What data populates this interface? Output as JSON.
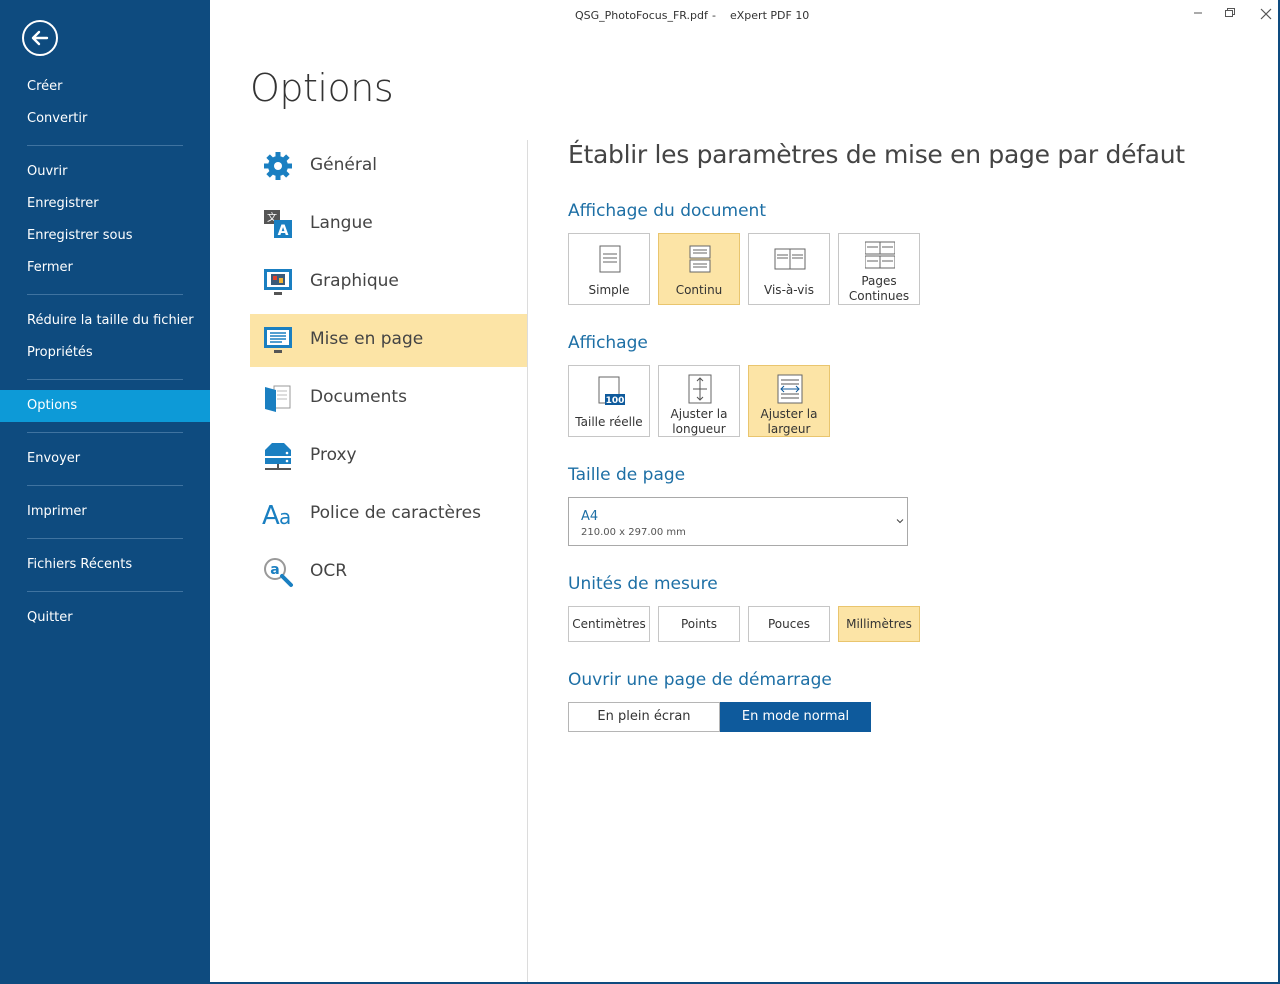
{
  "window": {
    "doc_name": "QSG_PhotoFocus_FR.pdf",
    "separator": "-",
    "app_name": "eXpert PDF 10"
  },
  "sidebar": {
    "items": [
      {
        "label": "Créer"
      },
      {
        "label": "Convertir"
      },
      {
        "label": "Ouvrir"
      },
      {
        "label": "Enregistrer"
      },
      {
        "label": "Enregistrer sous"
      },
      {
        "label": "Fermer"
      },
      {
        "label": "Réduire la taille du fichier"
      },
      {
        "label": "Propriétés"
      },
      {
        "label": "Options",
        "active": true
      },
      {
        "label": "Envoyer"
      },
      {
        "label": "Imprimer"
      },
      {
        "label": "Fichiers Récents"
      },
      {
        "label": "Quitter"
      }
    ]
  },
  "page": {
    "title": "Options"
  },
  "categories": [
    {
      "label": "Général",
      "icon": "gear-icon"
    },
    {
      "label": "Langue",
      "icon": "language-icon"
    },
    {
      "label": "Graphique",
      "icon": "monitor-graphic-icon"
    },
    {
      "label": "Mise en page",
      "icon": "page-layout-icon",
      "active": true
    },
    {
      "label": "Documents",
      "icon": "documents-icon"
    },
    {
      "label": "Proxy",
      "icon": "proxy-server-icon"
    },
    {
      "label": "Police de caractères",
      "icon": "font-icon"
    },
    {
      "label": "OCR",
      "icon": "ocr-magnifier-icon"
    }
  ],
  "main": {
    "heading": "Établir les paramètres de mise en page par défaut",
    "doc_view": {
      "title": "Affichage du document",
      "options": [
        {
          "label": "Simple",
          "selected": false
        },
        {
          "label": "Continu",
          "selected": true
        },
        {
          "label": "Vis-à-vis",
          "selected": false
        },
        {
          "label_line1": "Pages",
          "label_line2": "Continues",
          "selected": false
        }
      ]
    },
    "display": {
      "title": "Affichage",
      "options": [
        {
          "label": "Taille réelle",
          "badge": "100",
          "selected": false
        },
        {
          "label_line1": "Ajuster la",
          "label_line2": "longueur",
          "selected": false
        },
        {
          "label_line1": "Ajuster la",
          "label_line2": "largeur",
          "selected": true
        }
      ]
    },
    "page_size": {
      "title": "Taille de page",
      "value": "A4",
      "dimensions": "210.00 x 297.00 mm"
    },
    "units": {
      "title": "Unités de mesure",
      "options": [
        "Centimètres",
        "Points",
        "Pouces",
        "Millimètres"
      ],
      "selected": "Millimètres"
    },
    "start_page": {
      "title": "Ouvrir une page de démarrage",
      "fullscreen_label": "En plein écran",
      "normal_label": "En mode normal",
      "selected": "En mode normal"
    }
  },
  "colors": {
    "sidebar_bg": "#0e4b7f",
    "sidebar_active": "#0d9ad7",
    "selected_bg": "#fce4a6",
    "accent_text": "#1d6fa5",
    "primary_button": "#0e5a9c"
  }
}
